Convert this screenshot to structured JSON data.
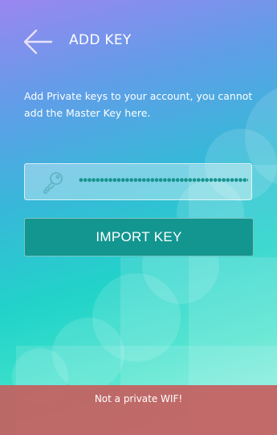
{
  "header": {
    "title": "ADD KEY",
    "back_icon": "arrow-left-icon"
  },
  "description": "Add Private keys to your account, you cannot add the Master Key here.",
  "key_field": {
    "icon": "key-icon",
    "value": "•••••••••••••••••••••••••••••••••••••••••••••••••••"
  },
  "import_button": {
    "label": "IMPORT KEY"
  },
  "error": {
    "message": "Not a private WIF!"
  },
  "colors": {
    "button": "#139690",
    "error_bar": "#c45e5e",
    "text": "#ffffff"
  }
}
